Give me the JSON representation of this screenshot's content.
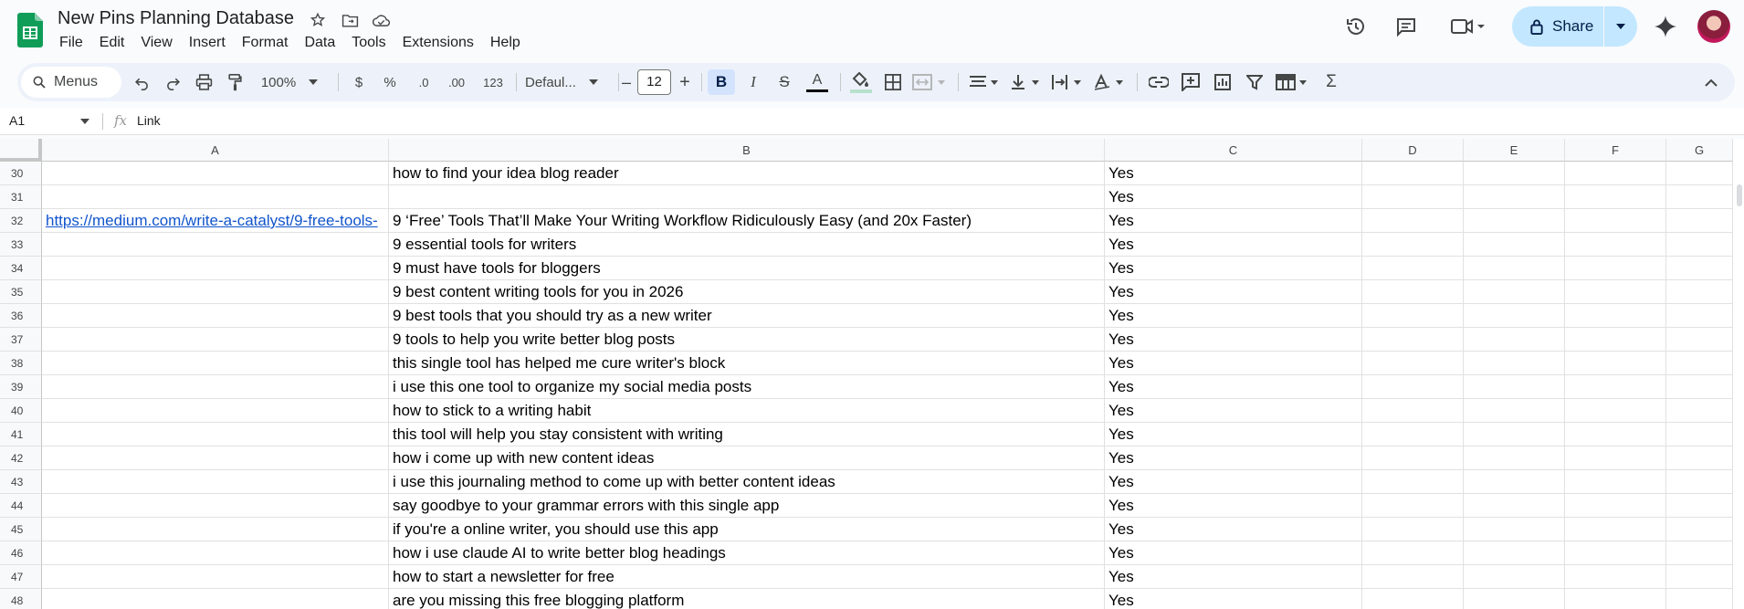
{
  "doc": {
    "title": "New Pins Planning Database"
  },
  "menu": [
    "File",
    "Edit",
    "View",
    "Insert",
    "Format",
    "Data",
    "Tools",
    "Extensions",
    "Help"
  ],
  "share": {
    "label": "Share"
  },
  "toolbar": {
    "search_label": "Menus",
    "zoom": "100%",
    "currency": "$",
    "percent": "%",
    "dec_decrease": ".0",
    "dec_increase": ".00",
    "number_format": "123",
    "font": "Defaul...",
    "font_size": "12",
    "bold": "B",
    "italic": "I",
    "strike": "S",
    "text_color": "A",
    "minus": "–",
    "plus": "+",
    "sum": "Σ"
  },
  "formula": {
    "cell_ref": "A1",
    "content": "Link",
    "fx": "fx"
  },
  "columns": [
    "A",
    "B",
    "C",
    "D",
    "E",
    "F",
    "G"
  ],
  "rows": [
    {
      "n": "30",
      "a": "",
      "b": "how to find your idea blog reader",
      "c": "Yes"
    },
    {
      "n": "31",
      "a": "",
      "b": "",
      "c": "Yes"
    },
    {
      "n": "32",
      "a": "https://medium.com/write-a-catalyst/9-free-tools-",
      "b": "9 ‘Free’ Tools That’ll Make Your Writing Workflow Ridiculously Easy (and 20x Faster)",
      "c": "Yes"
    },
    {
      "n": "33",
      "a": "",
      "b": "9 essential tools for writers",
      "c": "Yes"
    },
    {
      "n": "34",
      "a": "",
      "b": "9 must have tools for bloggers",
      "c": "Yes"
    },
    {
      "n": "35",
      "a": "",
      "b": "9 best content writing tools for you in 2026",
      "c": "Yes"
    },
    {
      "n": "36",
      "a": "",
      "b": "9 best tools that you should try as a new writer",
      "c": "Yes"
    },
    {
      "n": "37",
      "a": "",
      "b": "9 tools to help you write better blog posts",
      "c": "Yes"
    },
    {
      "n": "38",
      "a": "",
      "b": "this single tool has helped me cure writer's block",
      "c": "Yes"
    },
    {
      "n": "39",
      "a": "",
      "b": "i use this one tool to organize my social media posts",
      "c": "Yes"
    },
    {
      "n": "40",
      "a": "",
      "b": "how to stick to a writing habit",
      "c": "Yes"
    },
    {
      "n": "41",
      "a": "",
      "b": "this tool will help you stay consistent with writing",
      "c": "Yes"
    },
    {
      "n": "42",
      "a": "",
      "b": "how i come up with new content ideas",
      "c": "Yes"
    },
    {
      "n": "43",
      "a": "",
      "b": "i use this journaling method to come up with better content ideas",
      "c": "Yes"
    },
    {
      "n": "44",
      "a": "",
      "b": "say goodbye to your grammar errors with this single app",
      "c": "Yes"
    },
    {
      "n": "45",
      "a": "",
      "b": "if you're a online writer, you should use this app",
      "c": "Yes"
    },
    {
      "n": "46",
      "a": "",
      "b": "how i use claude AI to write better blog headings",
      "c": "Yes"
    },
    {
      "n": "47",
      "a": "",
      "b": "how to start a newsletter for free",
      "c": "Yes"
    },
    {
      "n": "48",
      "a": "",
      "b": "are you missing this free blogging platform",
      "c": "Yes"
    }
  ]
}
